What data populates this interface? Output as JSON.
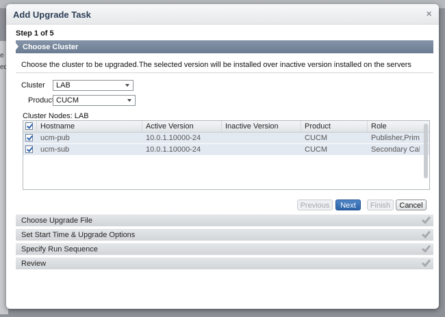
{
  "dialog": {
    "title": "Add Upgrade Task",
    "close_glyph": "×",
    "step": "Step 1 of 5",
    "section": "Choose Cluster",
    "description": "Choose the cluster to be upgraded.The selected version will be installed over inactive version installed on the servers"
  },
  "form": {
    "cluster_label": "Cluster",
    "cluster_value": "LAB",
    "product_label": "Product",
    "product_value": "CUCM",
    "nodes_label": "Cluster Nodes: LAB"
  },
  "grid": {
    "headers": [
      "Hostname",
      "Active Version",
      "Inactive Version",
      "Product",
      "Role"
    ],
    "rows": [
      {
        "hostname": "ucm-pub",
        "active": "10.0.1.10000-24",
        "inactive": "",
        "product": "CUCM",
        "role": "Publisher,Primary"
      },
      {
        "hostname": "ucm-sub",
        "active": "10.0.1.10000-24",
        "inactive": "",
        "product": "CUCM",
        "role": "Secondary Call Pr"
      }
    ]
  },
  "buttons": {
    "previous": "Previous",
    "next": "Next",
    "finish": "Finish",
    "cancel": "Cancel"
  },
  "steps": [
    "Choose Upgrade File",
    "Set Start Time & Upgrade Options",
    "Specify Run Sequence",
    "Review"
  ],
  "background": {
    "left_fragments": [
      "e",
      "ect"
    ]
  },
  "colors": {
    "section_header": "#6b7c92",
    "primary_button": "#2c63a8",
    "row_highlight": "#e3e9f1"
  }
}
